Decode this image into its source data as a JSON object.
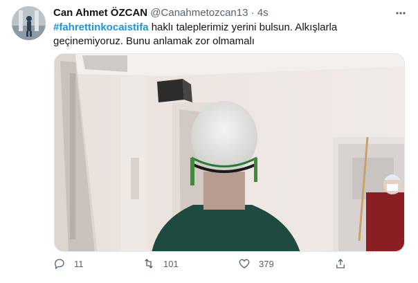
{
  "tweet": {
    "author_name": "Can Ahmet ÖZCAN",
    "handle": "@Canahmetozcan13",
    "separator": "·",
    "time": "4s",
    "hashtag": "#fahrettinkocaistifa",
    "text_after_hashtag": " haklı taleplerimiz yerini bulsun. Alkışlarla",
    "text_line2": "geçinemiyoruz.  Bunu anlamak zor olmamalı",
    "replies": "11",
    "retweets": "101",
    "likes": "379"
  },
  "icons": {
    "more": "more-icon",
    "reply": "reply-icon",
    "retweet": "retweet-icon",
    "like": "heart-icon",
    "share": "share-icon"
  },
  "colors": {
    "text": "#0f1419",
    "secondary": "#536471",
    "hashtag": "#1b95e0"
  }
}
